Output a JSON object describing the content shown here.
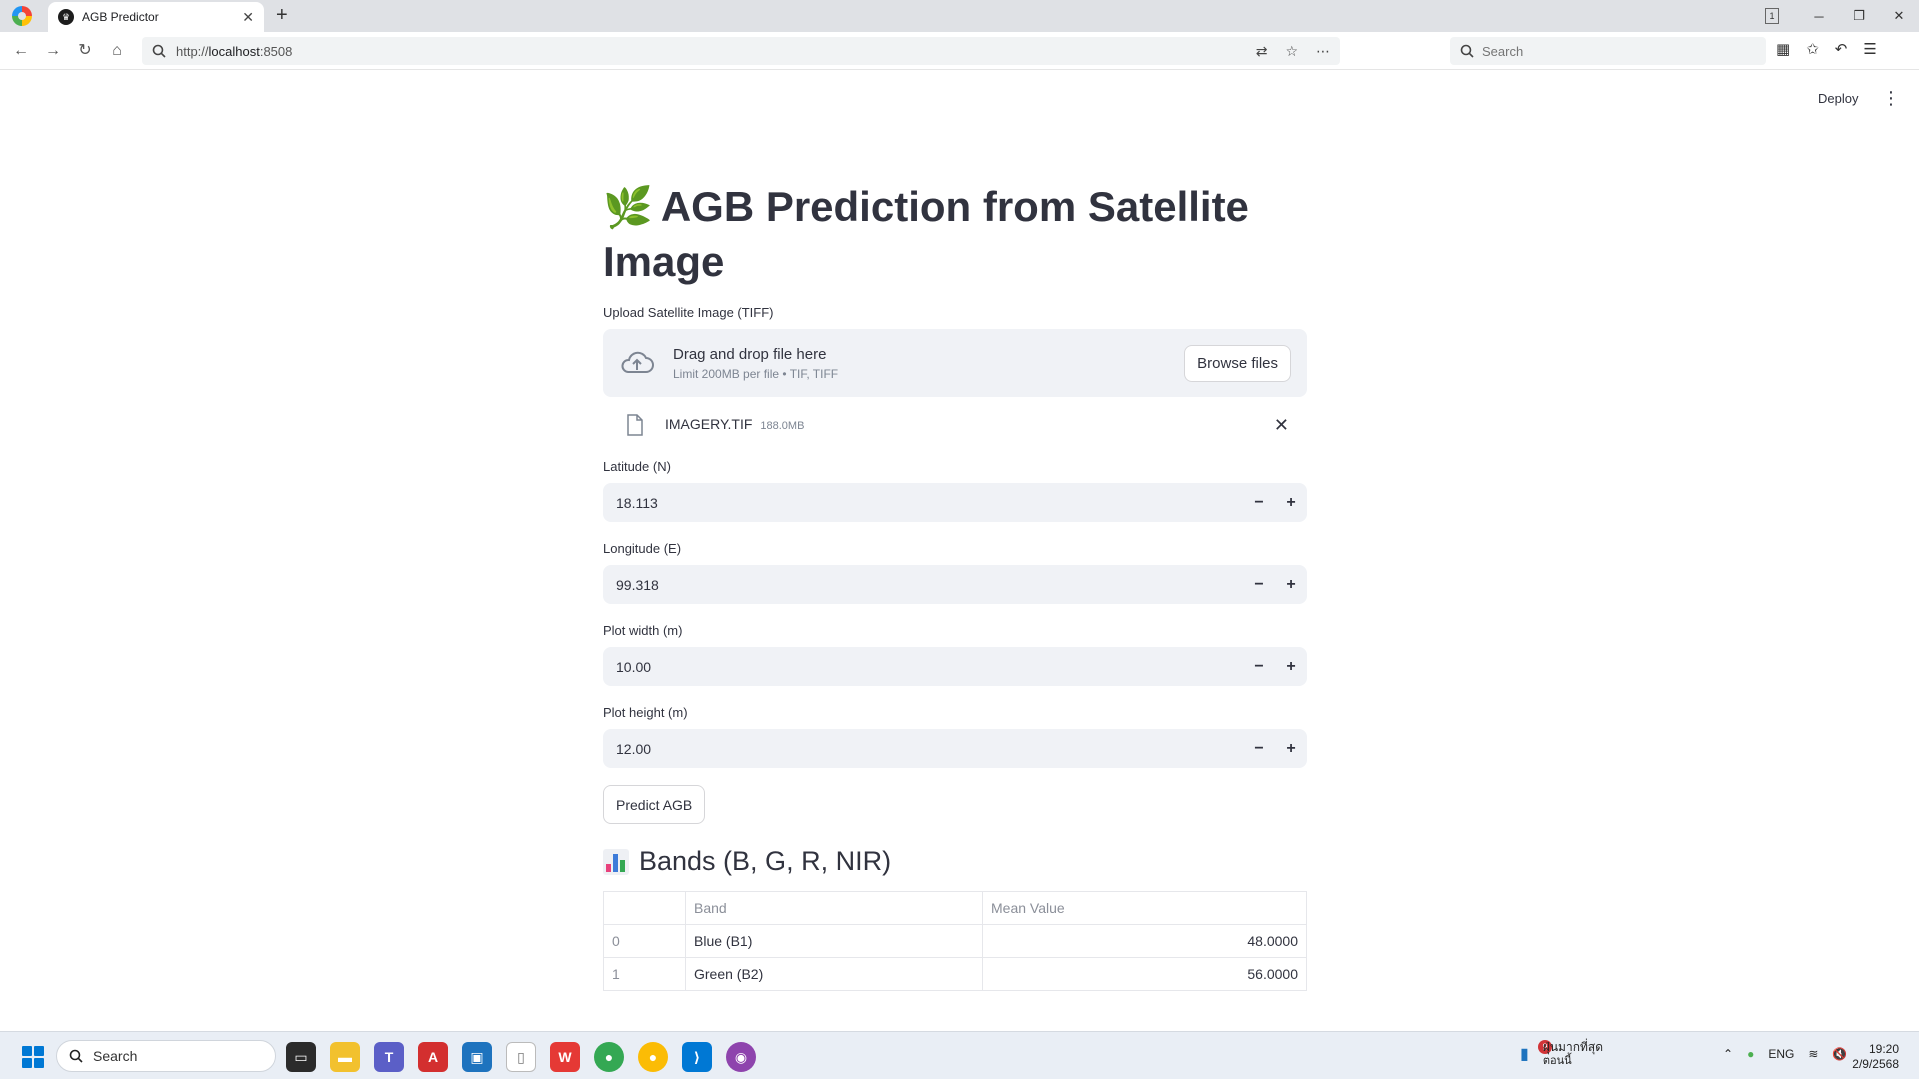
{
  "browser": {
    "tab_title": "AGB Predictor",
    "url_prefix": "http://",
    "url_host": "localhost",
    "url_port": ":8508",
    "search_placeholder": "Search",
    "tab_count": "1"
  },
  "header": {
    "deploy_label": "Deploy"
  },
  "main": {
    "title": "AGB Prediction from Satellite Image",
    "upload": {
      "label": "Upload Satellite Image (TIFF)",
      "drop_title": "Drag and drop file here",
      "drop_sub": "Limit 200MB per file • TIF, TIFF",
      "browse_label": "Browse files",
      "file_name": "IMAGERY.TIF",
      "file_size": "188.0MB"
    },
    "fields": [
      {
        "label": "Latitude (N)",
        "value": "18.113"
      },
      {
        "label": "Longitude (E)",
        "value": "99.318"
      },
      {
        "label": "Plot width (m)",
        "value": "10.00"
      },
      {
        "label": "Plot height (m)",
        "value": "12.00"
      }
    ],
    "predict_label": "Predict AGB",
    "bands_header": "Bands (B, G, R, NIR)",
    "table": {
      "columns": [
        "",
        "Band",
        "Mean Value"
      ],
      "rows": [
        {
          "index": "0",
          "band": "Blue (B1)",
          "mean": "48.0000"
        },
        {
          "index": "1",
          "band": "Green (B2)",
          "mean": "56.0000"
        }
      ]
    }
  },
  "taskbar": {
    "search_label": "Search",
    "notif_count": "9",
    "weather_line1": "ฝุ่นมากที่สุด",
    "weather_line2": "ตอนนี้",
    "lang": "ENG",
    "time": "19:20",
    "date": "2/9/2568"
  },
  "colors": {
    "accent": "#ff4b4b",
    "input_bg": "#f0f2f6",
    "text": "#31333f"
  }
}
